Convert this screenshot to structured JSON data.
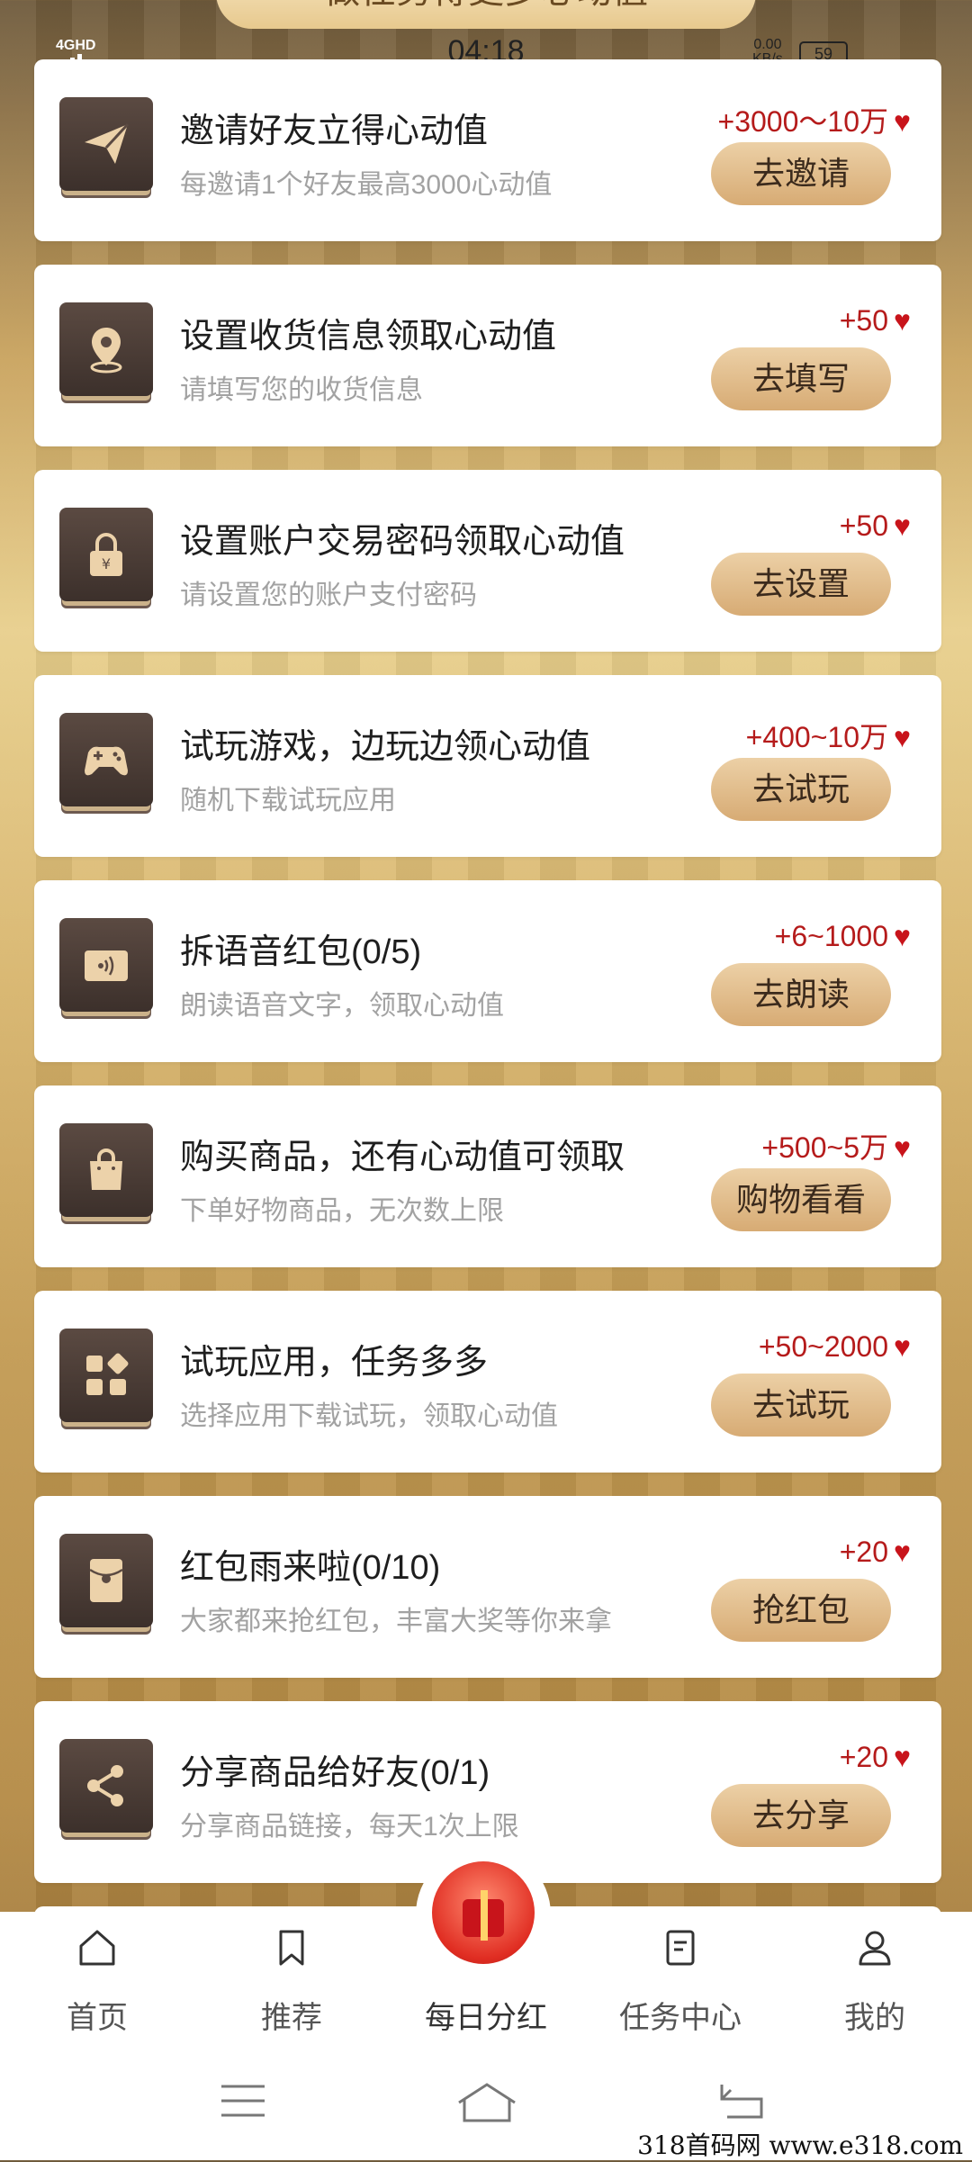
{
  "banner": {
    "text": "做任务得更多心动值"
  },
  "status_bar": {
    "network": "4GHD",
    "time": "04:18",
    "speed_value": "0.00",
    "speed_unit": "KB/s",
    "battery": "59"
  },
  "tasks": [
    {
      "title": "邀请好友立得心动值",
      "desc": "每邀请1个好友最高3000心动值",
      "reward": "+3000～10万",
      "button": "去邀请",
      "icon": "paper-plane-icon"
    },
    {
      "title": "设置收货信息领取心动值",
      "desc": "请填写您的收货信息",
      "reward": "+50",
      "button": "去填写",
      "icon": "location-pin-icon"
    },
    {
      "title": "设置账户交易密码领取心动值",
      "desc": "请设置您的账户支付密码",
      "reward": "+50",
      "button": "去设置",
      "icon": "lock-icon"
    },
    {
      "title": "试玩游戏，边玩边领心动值",
      "desc": "随机下载试玩应用",
      "reward": "+400~10万",
      "button": "去试玩",
      "icon": "gamepad-icon"
    },
    {
      "title": "拆语音红包(0/5)",
      "desc": "朗读语音文字，领取心动值",
      "reward": "+6~1000",
      "button": "去朗读",
      "icon": "voice-envelope-icon"
    },
    {
      "title": "购买商品，还有心动值可领取",
      "desc": "下单好物商品，无次数上限",
      "reward": "+500~5万",
      "button": "购物看看",
      "icon": "shopping-bag-icon"
    },
    {
      "title": "试玩应用，任务多多",
      "desc": "选择应用下载试玩，领取心动值",
      "reward": "+50~2000",
      "button": "去试玩",
      "icon": "apps-grid-icon"
    },
    {
      "title": "红包雨来啦(0/10)",
      "desc": "大家都来抢红包，丰富大奖等你来拿",
      "reward": "+20",
      "button": "抢红包",
      "icon": "red-envelope-icon"
    },
    {
      "title": "分享商品给好友(0/1)",
      "desc": "分享商品链接，每天1次上限",
      "reward": "+20",
      "button": "去分享",
      "icon": "share-icon"
    }
  ],
  "tabbar": {
    "items": [
      {
        "label": "首页",
        "icon": "home-icon"
      },
      {
        "label": "推荐",
        "icon": "bookmark-icon"
      },
      {
        "label": "每日分红",
        "icon": "gift-icon"
      },
      {
        "label": "任务中心",
        "icon": "task-list-icon"
      },
      {
        "label": "我的",
        "icon": "user-icon"
      }
    ]
  },
  "watermark": "318首码网 www.e318.com",
  "colors": {
    "accent_reward": "#b51b1b",
    "button_bg": "#ddb47e",
    "heart": "#c8141b"
  }
}
